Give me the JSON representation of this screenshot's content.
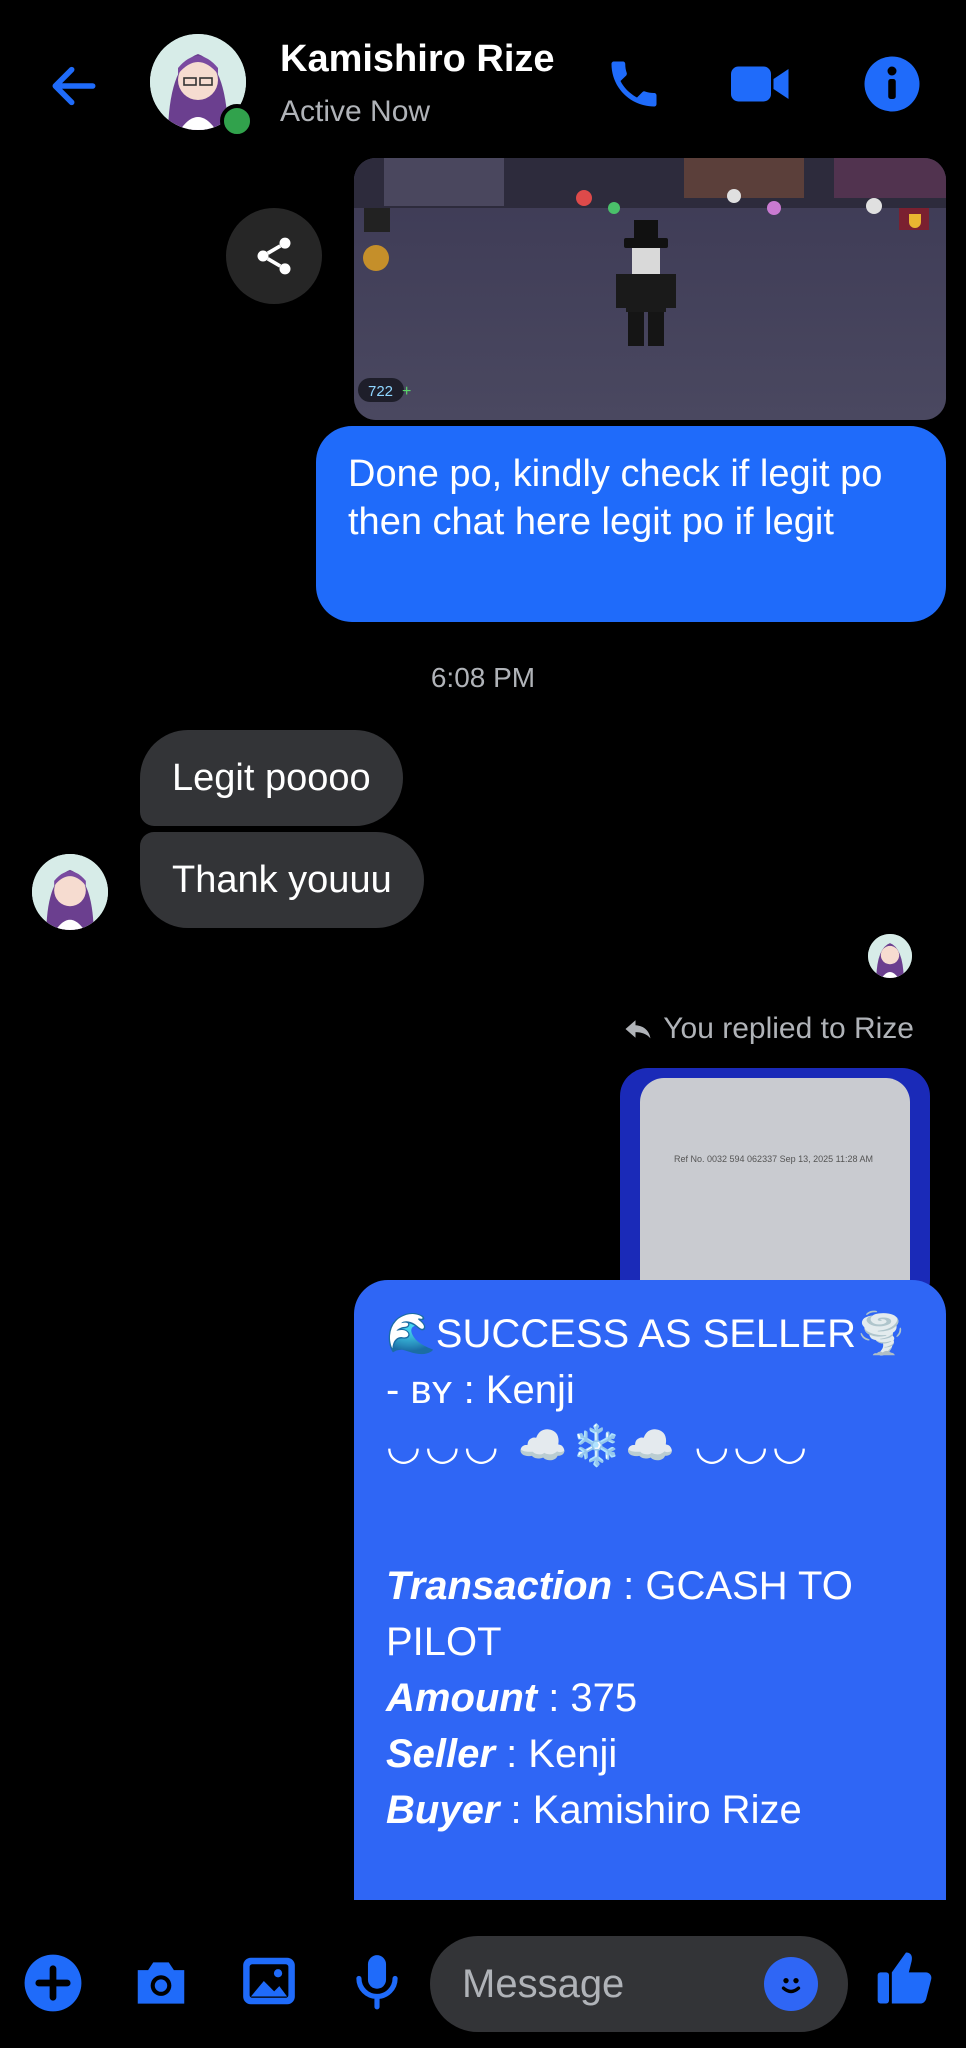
{
  "header": {
    "contact_name": "Kamishiro Rize",
    "status": "Active Now"
  },
  "messages": {
    "outgoing_1": "Done po, kindly check if legit po then chat here legit po if legit",
    "timestamp": "6:08 PM",
    "incoming_1": "Legit poooo",
    "incoming_2": "Thank youuu",
    "reply_label": "You replied to Rize",
    "reply_ref": "Ref No. 0032 594 062337  Sep 13, 2025 11:28 AM"
  },
  "seller_card": {
    "title": "🌊SUCCESS AS SELLER🌪️",
    "by_line": "- ʙʏ : Kenji",
    "decor": "◡◡◡ ☁️❄️☁️ ◡◡◡",
    "fields": [
      {
        "label": "Transaction",
        "value": " : GCASH TO PILOT"
      },
      {
        "label": "Amount",
        "value": " : 375"
      },
      {
        "label": "Seller",
        "value": " : Kenji"
      },
      {
        "label": "Buyer",
        "value": " : Kamishiro Rize"
      }
    ]
  },
  "game_overlay": {
    "gem_count": "722"
  },
  "composer": {
    "placeholder": "Message"
  },
  "colors": {
    "accent": "#1f6bfa",
    "bubble_in": "#333437",
    "online": "#31a24c"
  }
}
